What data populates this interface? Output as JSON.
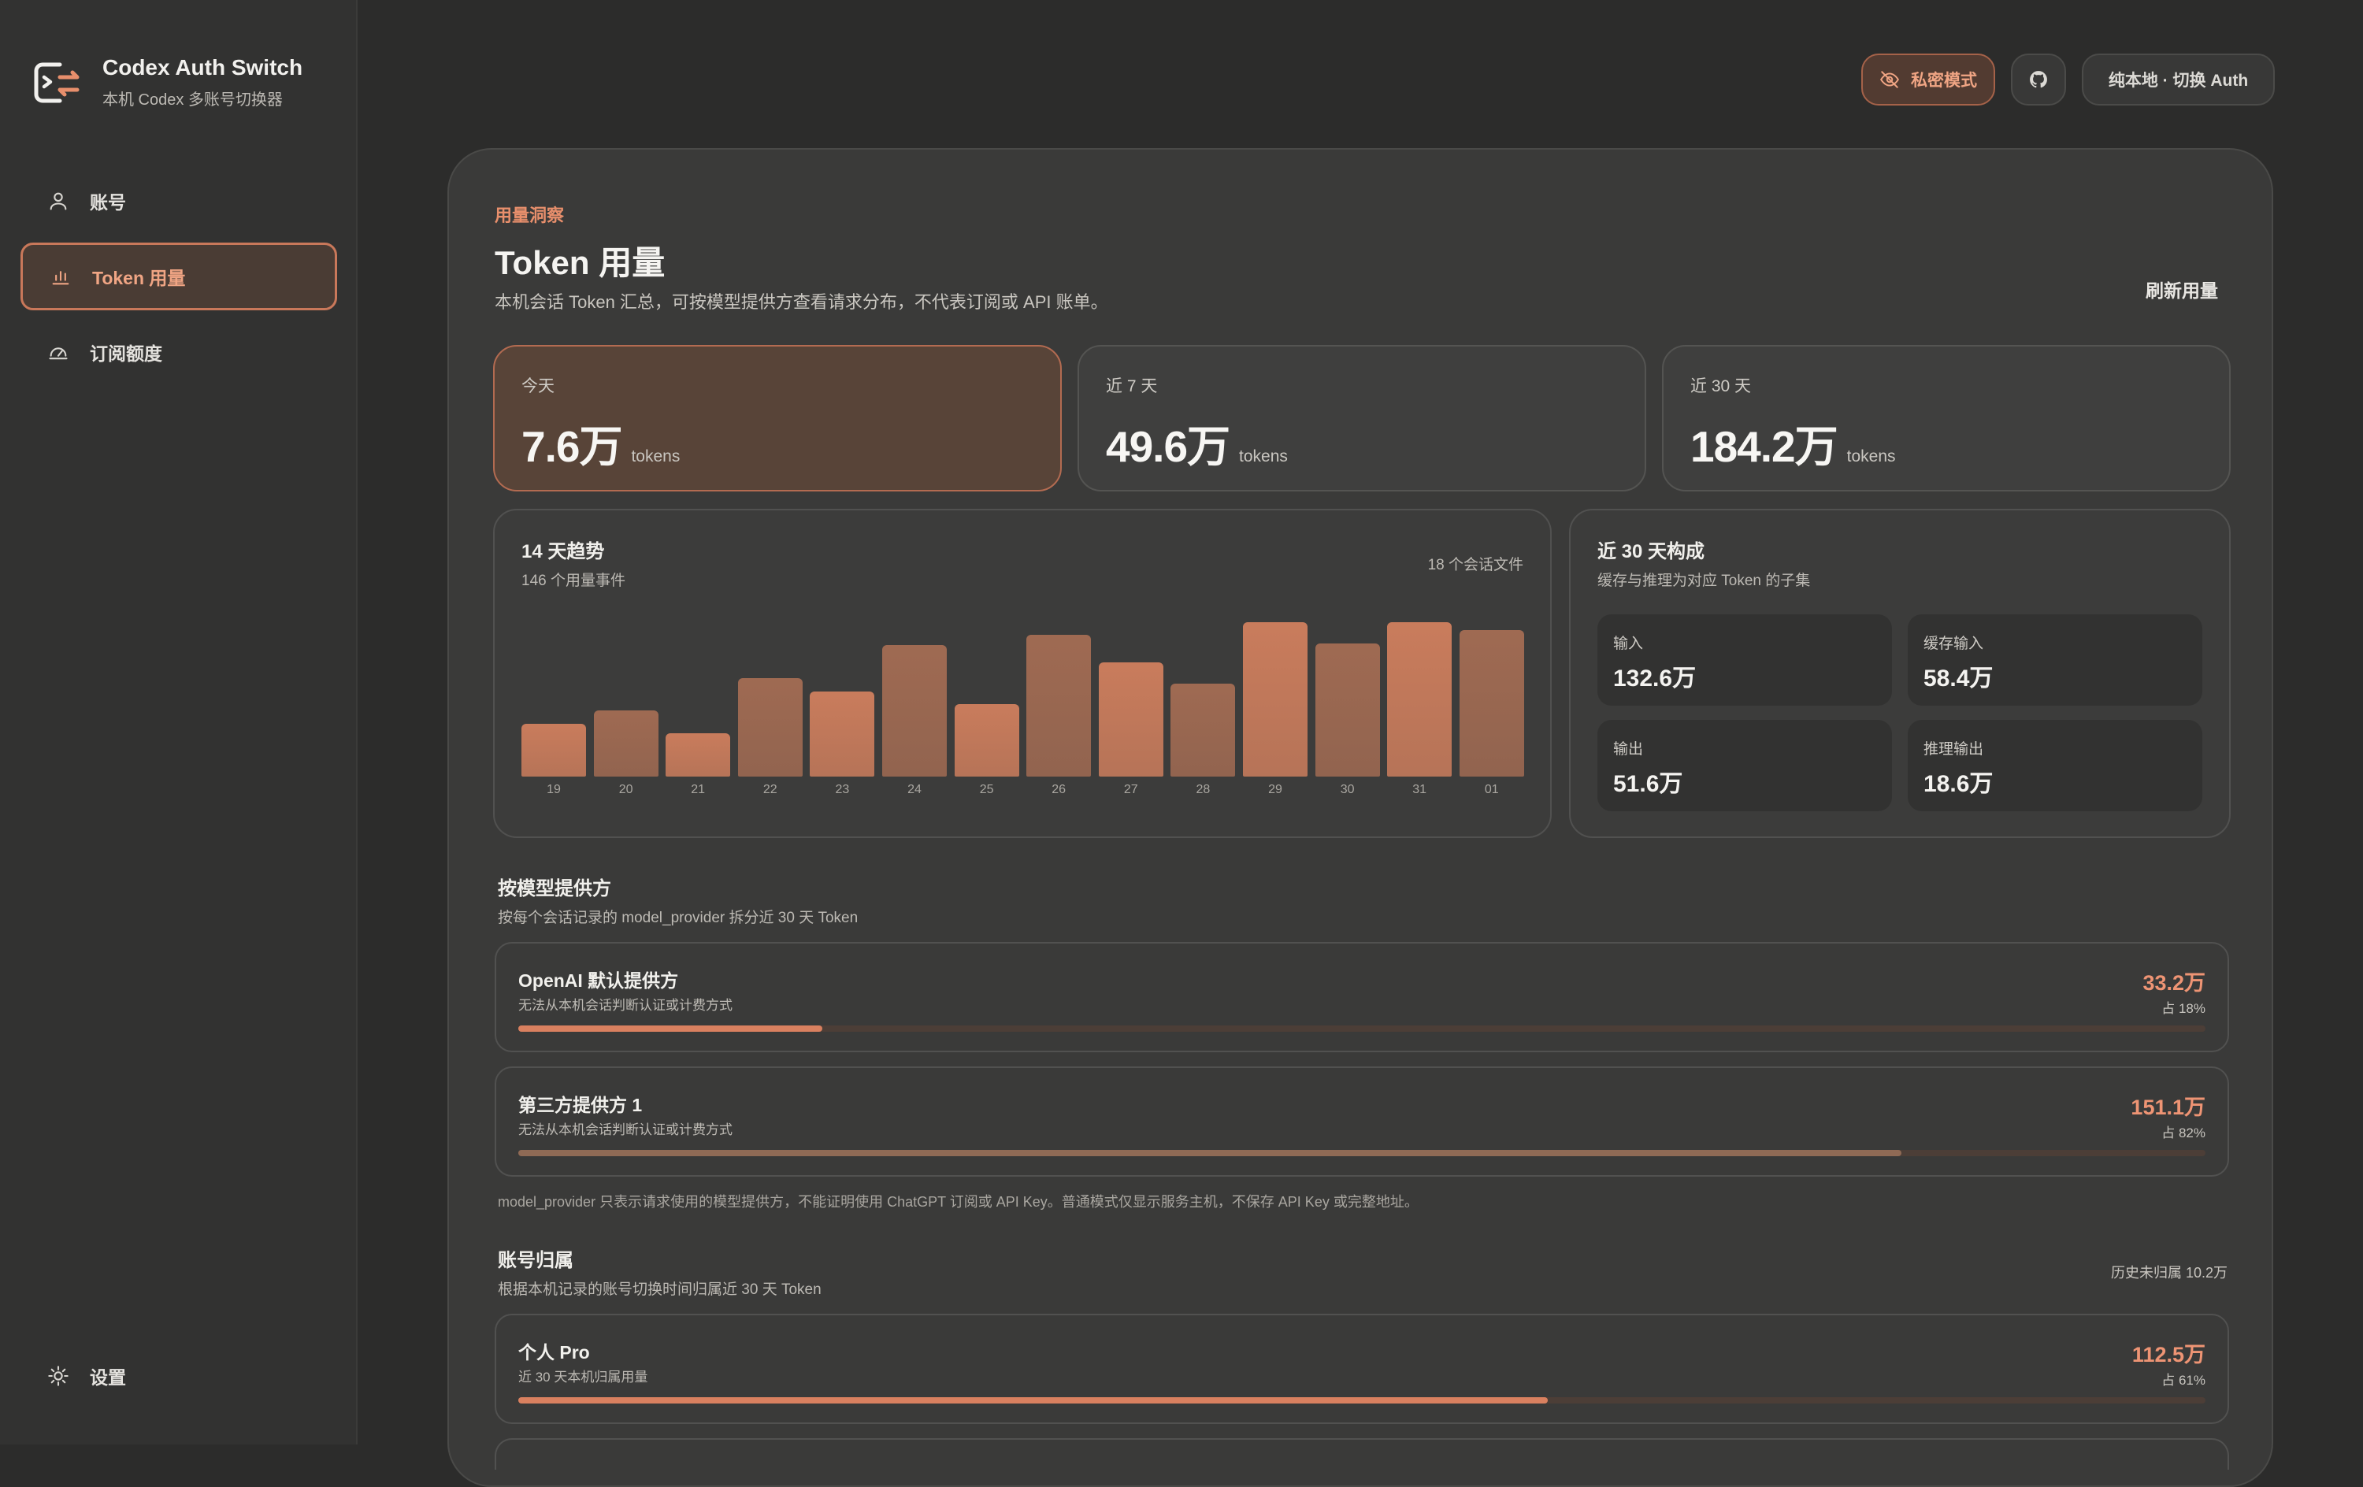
{
  "app": {
    "title": "Codex Auth Switch",
    "subtitle": "本机 Codex 多账号切换器"
  },
  "sidebar": {
    "items": [
      {
        "label": "账号",
        "icon": "user-icon",
        "active": false
      },
      {
        "label": "Token 用量",
        "icon": "bar-chart-icon",
        "active": true
      },
      {
        "label": "订阅额度",
        "icon": "gauge-icon",
        "active": false
      }
    ],
    "settings_label": "设置"
  },
  "topbar": {
    "private_label": "私密模式",
    "github_icon": "github-icon",
    "local_label": "纯本地 · 切换 Auth"
  },
  "page": {
    "eyebrow": "用量洞察",
    "title": "Token 用量",
    "description": "本机会话 Token 汇总，可按模型提供方查看请求分布，不代表订阅或 API 账单。",
    "refresh_label": "刷新用量"
  },
  "stats": [
    {
      "label": "今天",
      "value": "7.6万",
      "unit": "tokens"
    },
    {
      "label": "近 7 天",
      "value": "49.6万",
      "unit": "tokens"
    },
    {
      "label": "近 30 天",
      "value": "184.2万",
      "unit": "tokens"
    }
  ],
  "trend": {
    "title": "14 天趋势",
    "subtitle": "146 个用量事件",
    "files": "18 个会话文件"
  },
  "chart_data": {
    "type": "bar",
    "categories": [
      "19",
      "20",
      "21",
      "22",
      "23",
      "24",
      "25",
      "26",
      "27",
      "28",
      "29",
      "30",
      "31",
      "01"
    ],
    "values": [
      0.34,
      0.43,
      0.28,
      0.64,
      0.55,
      0.85,
      0.47,
      0.92,
      0.74,
      0.6,
      1.0,
      0.86,
      1.0,
      0.95
    ],
    "colors": {
      "light": "#c97c5c",
      "dark": "#9f6a52"
    }
  },
  "composition": {
    "title": "近 30 天构成",
    "subtitle": "缓存与推理为对应 Token 的子集",
    "items": [
      {
        "label": "输入",
        "value": "132.6万"
      },
      {
        "label": "缓存输入",
        "value": "58.4万"
      },
      {
        "label": "输出",
        "value": "51.6万"
      },
      {
        "label": "推理输出",
        "value": "18.6万"
      }
    ]
  },
  "providers": {
    "title": "按模型提供方",
    "subtitle": "按每个会话记录的 model_provider 拆分近 30 天 Token",
    "rows": [
      {
        "name": "OpenAI 默认提供方",
        "desc": "无法从本机会话判断认证或计费方式",
        "value": "33.2万",
        "share": "占 18%",
        "percent": 0.18
      },
      {
        "name": "第三方提供方 1",
        "desc": "无法从本机会话判断认证或计费方式",
        "value": "151.1万",
        "share": "占 82%",
        "percent": 0.82
      }
    ],
    "note": "model_provider 只表示请求使用的模型提供方，不能证明使用 ChatGPT 订阅或 API Key。普通模式仅显示服务主机，不保存 API Key 或完整地址。"
  },
  "accounts": {
    "title": "账号归属",
    "subtitle": "根据本机记录的账号切换时间归属近 30 天 Token",
    "unassigned": "历史未归属 10.2万",
    "rows": [
      {
        "name": "个人 Pro",
        "desc": "近 30 天本机归属用量",
        "value": "112.5万",
        "share": "占 61%",
        "percent": 0.61
      }
    ]
  },
  "colors": {
    "accent": "#e88f6c",
    "bg": "#2c2c2b",
    "panel": "#3a3a39"
  }
}
